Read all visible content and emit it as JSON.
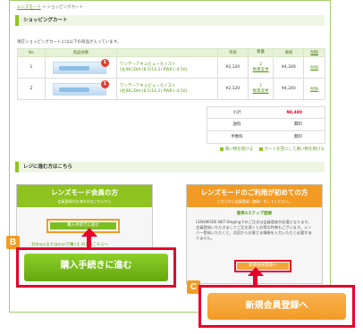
{
  "breadcrumb": {
    "home": "レンズモード",
    "sep": " > ",
    "current": "ショッピングカート"
  },
  "cart_title": "ショッピングカート",
  "intro": "現在ショッピングカートには以下の商品が入っています。",
  "table": {
    "headers": [
      "No",
      "商品画像",
      "",
      "単価",
      "数量",
      "価格",
      "削除"
    ],
    "rows": [
      {
        "no": "1",
        "name1": "ワンデーアキュビューモイスト",
        "name2": "[左]BC/DIA:(8.5/14.2) PWR:(-4.50)",
        "price": "¥2,120",
        "qty": "2",
        "qty_change": "数量変更",
        "subtotal": "¥4,240",
        "delete": "削除"
      },
      {
        "no": "2",
        "name1": "ワンデーアキュビューモイスト",
        "name2": "[右]BC/DIA:(8.5/14.2) PWR:(-4.50)",
        "price": "¥2,120",
        "qty": "2",
        "qty_change": "数量変更",
        "subtotal": "¥4,240",
        "delete": "削除"
      }
    ],
    "badge": "1"
  },
  "summary": {
    "subtotal_label": "小計",
    "subtotal": "¥8,480",
    "shipping_label": "送料",
    "shipping": "無料",
    "fee_label": "手数料",
    "fee": "無料"
  },
  "links": {
    "continue": "買い物を続ける",
    "empty_cart": "カートを空にして買い物を続ける"
  },
  "checkout_title": "レジに進む方はこちら",
  "member": {
    "title": "レンズモード会員の方",
    "subtitle": "会員登録がお済の方はこちらから",
    "button": "購入手続きに進む",
    "yahoo": "【Yahoo!またはmixiで購入】の方はこちらへ",
    "big_button": "購入手続きに進む"
  },
  "new_user": {
    "title": "レンズモードのご利用が初めての方",
    "subtitle": "こちらから会員登録（無料）をしてください。",
    "step": "簡単3ステップ登録",
    "body": "LENSMODE.NET-Stagingでのご注文は会員登録が必要となります。会員登録いただきましてご注文頂くとお得な特典もございます。メンバー登録いただくと、次回からお客さま情報を入力いただく必要がありません。",
    "button": "新規会員登録へ",
    "big_button": "新規会員登録へ"
  },
  "markers": {
    "b": "B",
    "c": "C"
  }
}
